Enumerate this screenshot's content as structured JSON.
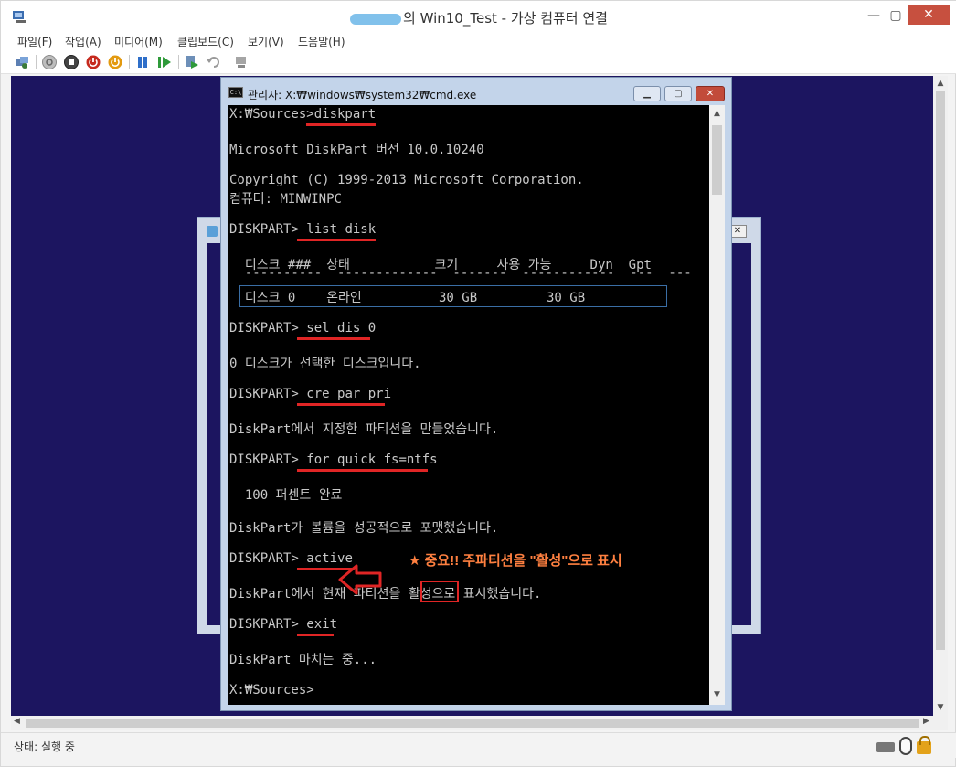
{
  "window": {
    "title_suffix": "의 Win10_Test - 가상 컴퓨터 연결",
    "minimize": "—",
    "maximize": "▢",
    "close": "✕"
  },
  "menu": [
    "파일(F)",
    "작업(A)",
    "미디어(M)",
    "클립보드(C)",
    "보기(V)",
    "도움말(H)"
  ],
  "toolbar_icons": [
    "ctrl-alt-del-icon",
    "start-icon",
    "turn-off-icon",
    "shut-down-icon",
    "save-icon",
    "pause-icon",
    "reset-icon",
    "checkpoint-icon",
    "revert-icon",
    "enhanced-session-icon"
  ],
  "cmd": {
    "title": "관리자: X:₩windows₩system32₩cmd.exe",
    "lines": {
      "l1_prompt": "X:₩Sources>",
      "l1_cmd": "diskpart",
      "l2": "Microsoft DiskPart 버전 10.0.10240",
      "l3": "Copyright (C) 1999-2013 Microsoft Corporation.",
      "l4": "컴퓨터: MINWINPC",
      "l5_prompt": "DISKPART> ",
      "l5_cmd": "list disk",
      "hdr": "  디스크 ###  상태           크기     사용 가능     Dyn  Gpt",
      "dash": "  ----------  -------------  -------  ------------  ---  ---",
      "row": "  디스크 0    온라인          30 GB         30 GB",
      "l6_prompt": "DISKPART> ",
      "l6_cmd": "sel dis 0",
      "l7": "0 디스크가 선택한 디스크입니다.",
      "l8_prompt": "DISKPART> ",
      "l8_cmd": "cre par pri",
      "l9": "DiskPart에서 지정한 파티션을 만들었습니다.",
      "l10_prompt": "DISKPART> ",
      "l10_cmd": "for quick fs=ntfs",
      "l11": "  100 퍼센트 완료",
      "l12": "DiskPart가 볼륨을 성공적으로 포맷했습니다.",
      "l13_prompt": "DISKPART> ",
      "l13_cmd": "active",
      "l14_a": "DiskPart에서 현재 파티션을 ",
      "l14_b": "활성",
      "l14_c": "으로 표시했습니다.",
      "l15_prompt": "DISKPART> ",
      "l15_cmd": "exit",
      "l16": "DiskPart 마치는 중...",
      "l17": "X:₩Sources>"
    }
  },
  "annotation": "★ 중요!! 주파티션을 \"활성\"으로 표시",
  "status": "상태: 실행 중",
  "colors": {
    "guest_bg": "#1c1560",
    "accent_red": "#e02525",
    "annotation": "#ff8040"
  }
}
